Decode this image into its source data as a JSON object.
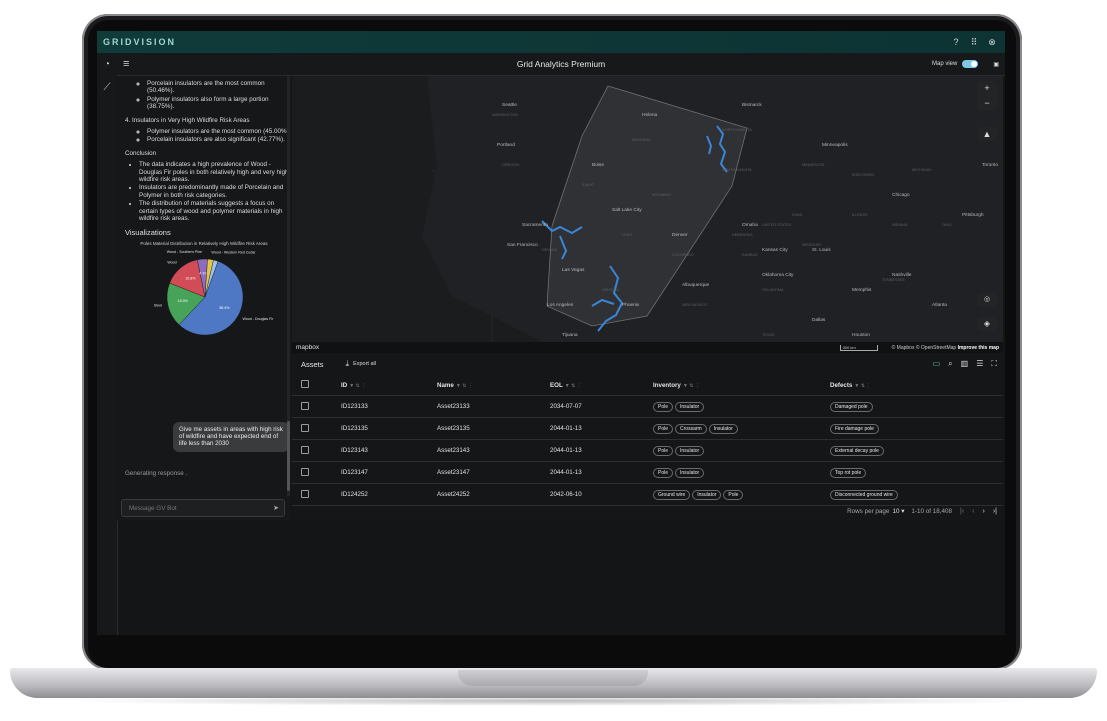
{
  "topbar": {
    "brand": "GRIDVISION"
  },
  "header": {
    "title": "Grid Analytics Premium",
    "map_view_label": "Map view"
  },
  "chat": {
    "porcelain_line": "Porcelain insulators are the most common (50.46%).",
    "polymer_line": "Polymer insulators also form a large portion (38.75%).",
    "section4": "4. Insulators in Very High Wildfire Risk Areas",
    "sec4_polymer": "Polymer insulators are the most common (45.00%).",
    "sec4_porcelain": "Porcelain insulators are also significant (42.77%).",
    "conclusion_title": "Conclusion",
    "conclusions": [
      "The data indicates a high prevalence of Wood - Douglas Fir poles in both relatively high and very high wildfire risk areas.",
      "Insulators are predominantly made of Porcelain and Polymer in both risk categories.",
      "The distribution of materials suggests a focus on certain types of wood and polymer materials in high wildfire risk areas."
    ],
    "visualizations_title": "Visualizations",
    "user_message": "Give me assets in areas with high risk of wildfire and have expected end of life less than 2030",
    "generating": "Generating response .",
    "message_placeholder": "Message GV Bot"
  },
  "chart_data": {
    "type": "pie",
    "title": "Poles Material Distribution in Relatively High Wildfire Risk Areas",
    "slices": [
      {
        "label": "Wood - Douglas Fir",
        "value": 56.4,
        "color": "#4f78c4"
      },
      {
        "label": "Steel",
        "value": 19.0,
        "color": "#47a35a"
      },
      {
        "label": "Wood",
        "value": 15.8,
        "color": "#d24c57"
      },
      {
        "label": "Wood - Southern Pine",
        "value": 4.3,
        "color": "#8b6cc1"
      },
      {
        "label": "Wood - Western Red Cedar",
        "value": 2.5,
        "color": "#e8c547"
      },
      {
        "label": "",
        "value": 2.0,
        "color": "#9cc3e6"
      }
    ],
    "data_labels": [
      "56.4%",
      "19.0%",
      "15.8%",
      "4.3%"
    ]
  },
  "map": {
    "cities": [
      "Seattle",
      "Portland",
      "Boise",
      "Helena",
      "Bismarck",
      "Minneapolis",
      "Toronto",
      "Chicago",
      "Pittsburgh",
      "Salt Lake City",
      "Denver",
      "San Francisco",
      "Sacramento",
      "Las Vegas",
      "Los Angeles",
      "Phoenix",
      "Albuquerque",
      "Dallas",
      "Houston",
      "Oklahoma City",
      "Kansas City",
      "Omaha",
      "St. Louis",
      "Memphis",
      "Nashville",
      "Atlanta",
      "Tijuana"
    ],
    "states": [
      "OREGON",
      "IDAHO",
      "UTAH",
      "NEVADA",
      "ARIZONA",
      "NEW MEXICO",
      "TEXAS",
      "KANSAS",
      "MISSOURI",
      "IOWA",
      "WISCONSIN",
      "MICHIGAN",
      "OHIO",
      "INDIANA",
      "ILLINOIS",
      "TENNESSEE",
      "COLORADO",
      "NEBRASKA",
      "SOUTH DAKOTA",
      "NORTH DAKOTA",
      "MONTANA",
      "WYOMING",
      "WASHINGTON",
      "MINNESOTA",
      "OKLAHOMA",
      "UNITED STATES"
    ],
    "scale_label": "300 km",
    "attribution": "© Mapbox © OpenStreetMap",
    "improve": "Improve this map",
    "mapbox_label": "mapbox"
  },
  "assets": {
    "title": "Assets",
    "export_label": "Export all",
    "columns": [
      "ID",
      "Name",
      "EOL",
      "Inventory",
      "Defects"
    ],
    "rows": [
      {
        "id": "ID123133",
        "name": "Asset23133",
        "eol": "2034-07-07",
        "inventory": [
          "Pole",
          "Insulator"
        ],
        "defects": [
          "Damaged pole"
        ]
      },
      {
        "id": "ID123135",
        "name": "Asset23135",
        "eol": "2044-01-13",
        "inventory": [
          "Pole",
          "Crossarm",
          "Insulator"
        ],
        "defects": [
          "Fire damage pole"
        ]
      },
      {
        "id": "ID123143",
        "name": "Asset23143",
        "eol": "2044-01-13",
        "inventory": [
          "Pole",
          "Insulator"
        ],
        "defects": [
          "External decay pole"
        ]
      },
      {
        "id": "ID123147",
        "name": "Asset23147",
        "eol": "2044-01-13",
        "inventory": [
          "Pole",
          "Insulator"
        ],
        "defects": [
          "Top rot pole"
        ]
      },
      {
        "id": "ID124252",
        "name": "Asset24252",
        "eol": "2042-06-10",
        "inventory": [
          "Ground wire",
          "Insulator",
          "Pole"
        ],
        "defects": [
          "Disconnected ground wire"
        ]
      }
    ],
    "rows_per_page_label": "Rows per page",
    "rows_per_page": "10",
    "range": "1-10 of 18,408"
  }
}
